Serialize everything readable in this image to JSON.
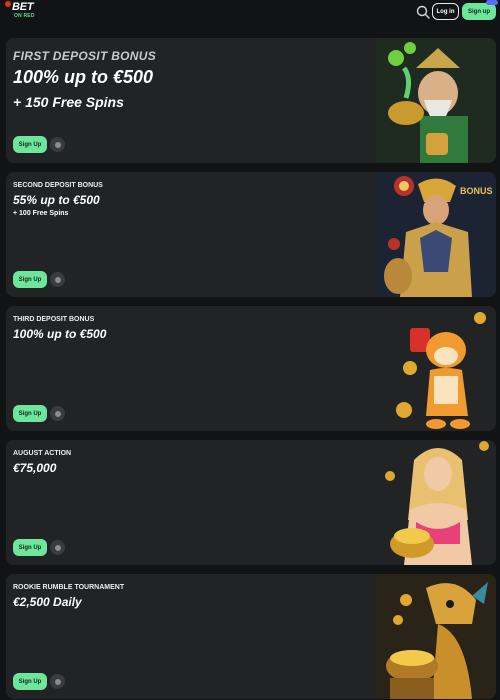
{
  "header": {
    "logo_main": "BET",
    "logo_sub": "ON RED",
    "login_label": "Log in",
    "signup_label": "Sign up"
  },
  "colors": {
    "background": "#121314",
    "card": "#222325",
    "accent_green": "#6ee59c",
    "brand_red": "#e0321c"
  },
  "icons": {
    "search": "search-icon",
    "info": "info-icon"
  },
  "promotions": [
    {
      "title": "FIRST DEPOSIT BONUS",
      "main": "100% up to €500",
      "sub": "+ 150 Free Spins",
      "button": "Sign Up",
      "art": "mage character with cauldron and FS coins"
    },
    {
      "title": "SECOND DEPOSIT BONUS",
      "main": "55% up to €500",
      "sub": "+ 100 Free Spins",
      "button": "Sign Up",
      "art": "armored warrior with bonus chips"
    },
    {
      "title": "THIRD DEPOSIT BONUS",
      "main": "100% up to €500",
      "sub": "",
      "button": "Sign Up",
      "art": "tiger character with coins"
    },
    {
      "title": "AUGUST ACTION",
      "main": "€75,000",
      "sub": "",
      "button": "Sign Up",
      "art": "woman with pot of gold coins"
    },
    {
      "title": "ROOKIE RUMBLE TOURNAMENT",
      "main": "€2,500 Daily",
      "sub": "",
      "button": "Sign Up",
      "art": "golden dragon with pot of coins"
    }
  ]
}
